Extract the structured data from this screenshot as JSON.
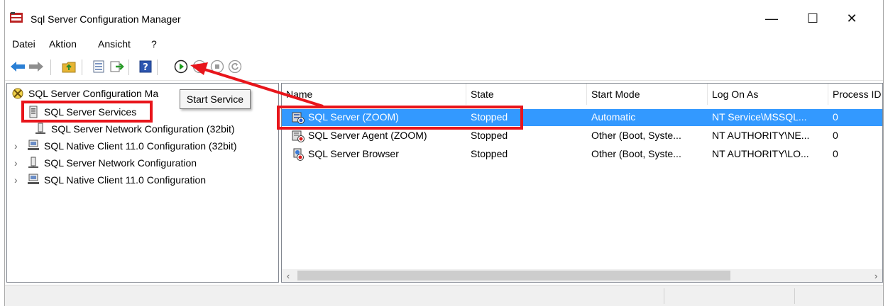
{
  "window": {
    "title": "Sql Server Configuration Manager",
    "minimize_glyph": "—",
    "maximize_glyph": "☐",
    "close_glyph": "✕"
  },
  "menu": [
    "Datei",
    "Aktion",
    "Ansicht",
    "?"
  ],
  "toolbar": {
    "icons": [
      "back-arrow-icon",
      "forward-arrow-icon",
      "up-folder-icon",
      "properties-icon",
      "export-icon",
      "help-icon",
      "start-service-icon",
      "pause-service-icon",
      "stop-service-icon",
      "restart-service-icon"
    ]
  },
  "tooltip": "Start Service",
  "tree": {
    "root": "SQL Server Configuration Manager (Local)",
    "root_visible": "SQL Server Configuration Ma",
    "items": [
      {
        "label": "SQL Server Services",
        "selected": true,
        "expandable": false
      },
      {
        "label": "SQL Server Network Configuration (32bit)",
        "expandable": false
      },
      {
        "label": "SQL Native Client 11.0 Configuration (32bit)",
        "expandable": true
      },
      {
        "label": "SQL Server Network Configuration",
        "expandable": true
      },
      {
        "label": "SQL Native Client 11.0 Configuration",
        "expandable": true
      }
    ]
  },
  "list": {
    "columns": [
      "Name",
      "State",
      "Start Mode",
      "Log On As",
      "Process ID"
    ],
    "rows": [
      {
        "name": "SQL Server (ZOOM)",
        "state": "Stopped",
        "start_mode": "Automatic",
        "log_on_as": "NT Service\\MSSQL...",
        "pid": "0",
        "selected": true
      },
      {
        "name": "SQL Server Agent (ZOOM)",
        "state": "Stopped",
        "start_mode": "Other (Boot, Syste...",
        "log_on_as": "NT AUTHORITY\\NE...",
        "pid": "0"
      },
      {
        "name": "SQL Server Browser",
        "state": "Stopped",
        "start_mode": "Other (Boot, Syste...",
        "log_on_as": "NT AUTHORITY\\LO...",
        "pid": "0"
      }
    ]
  },
  "colors": {
    "selection": "#3399ff",
    "highlight": "#e8151b"
  }
}
